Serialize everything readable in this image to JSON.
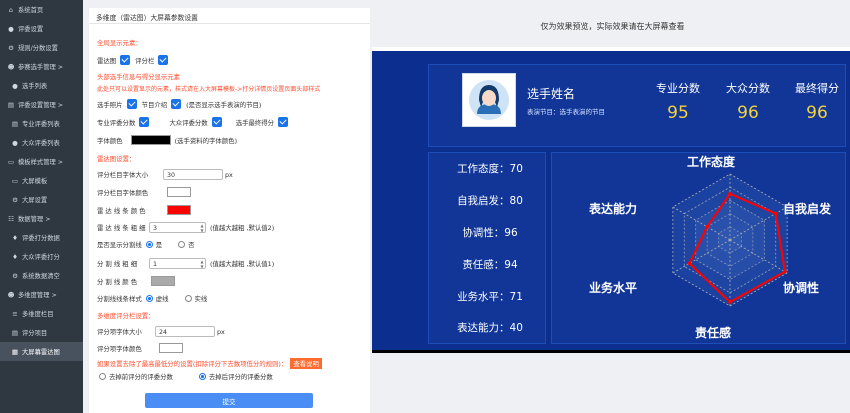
{
  "sidebar": {
    "items": [
      {
        "label": "系统首页",
        "icon": "home-icon",
        "glyph": "⌂"
      },
      {
        "label": "评委设置",
        "icon": "user-icon",
        "glyph": "●"
      },
      {
        "label": "规则/分数设置",
        "icon": "gear-icon",
        "glyph": "⚙"
      },
      {
        "label": "参赛选手管理 >",
        "icon": "group-icon",
        "glyph": "☻"
      },
      {
        "label": "选手列表",
        "icon": "user-icon",
        "glyph": "●"
      },
      {
        "label": "评委设置管理 >",
        "icon": "doc-icon",
        "glyph": "▤"
      },
      {
        "label": "专业评委列表",
        "icon": "doc-icon",
        "glyph": "▤"
      },
      {
        "label": "大众评委列表",
        "icon": "user-icon",
        "glyph": "●"
      },
      {
        "label": "模板样式管理 >",
        "icon": "monitor-icon",
        "glyph": "▭"
      },
      {
        "label": "大屏模板",
        "icon": "monitor-icon",
        "glyph": "▭"
      },
      {
        "label": "大屏设置",
        "icon": "gear-icon",
        "glyph": "⚙"
      },
      {
        "label": "数据管理 >",
        "icon": "cart-icon",
        "glyph": "☷"
      },
      {
        "label": "评委打分数据",
        "icon": "bell-icon",
        "glyph": "♦"
      },
      {
        "label": "大众评委打分",
        "icon": "bell-icon",
        "glyph": "♦"
      },
      {
        "label": "系统数据清空",
        "icon": "gear-icon",
        "glyph": "⚙"
      },
      {
        "label": "多维度管理 >",
        "icon": "group-icon",
        "glyph": "☻"
      },
      {
        "label": "多维度栏目",
        "icon": "list-icon",
        "glyph": "≡"
      },
      {
        "label": "评分项目",
        "icon": "doc-icon",
        "glyph": "▤"
      },
      {
        "label": "大屏幕雷达图",
        "icon": "grid-icon",
        "glyph": "▦",
        "active": true
      }
    ]
  },
  "form": {
    "title": "多维度（雷达图）大屏幕参数设置",
    "sec_global": "全局显示元素：",
    "radar_label": "雷达图",
    "score_bar_label": "评分栏",
    "sec_header": "头部选手信息与得分显示元素",
    "header_note": "此处只可以设置显示的元素，样式请在入大屏幕模板->打分详情页设置页面头部样式",
    "photo_label": "选手照片",
    "program_label": "节目介绍",
    "program_note": "(是否显示选手表演的节目)",
    "pro_score_label": "专业评委分数",
    "public_score_label": "大众评委分数",
    "final_score_label": "选手最终得分",
    "font_color_label": "字体颜色",
    "font_color_note": "(选手资料的字体颜色)",
    "font_color": "#000000",
    "sec_radar": "雷达图设置：",
    "score_font_size_label": "评分栏目字体大小",
    "score_font_size": "30",
    "score_font_size_unit": "px",
    "score_font_color_label": "评分栏目字体颜色",
    "score_font_color": "#ffffff",
    "radar_line_color_label": "雷 达 线 条 颜 色",
    "radar_line_color": "#ff0000",
    "radar_line_width_label": "雷 达 线 条 粗 细",
    "radar_line_width": "3",
    "radar_line_width_note": "(值越大越粗 ,默认值2)",
    "split_line_show_label": "是否显示分割线",
    "yes": "是",
    "no": "否",
    "split_line_width_label": "分 割 线 粗 细",
    "split_line_width": "1",
    "split_line_width_note": "(值越大越粗 ,默认值1)",
    "split_line_color_label": "分 割 线 颜 色",
    "split_line_color": "#aaaaaa",
    "split_line_style_label": "分割线线条样式",
    "dashed": "虚线",
    "solid": "实线",
    "sec_multi": "多维度评分栏设置：",
    "item_font_size_label": "评分项字体大小",
    "item_font_size": "24",
    "item_font_size_unit": "px",
    "item_font_color_label": "评分项字体颜色",
    "item_font_color": "#ffffff",
    "sec_remove": "如果设置去除了最高最低分的设置(扣除评分下去数项低分的规则)：",
    "view_help": "查看说明",
    "opt_before": "去掉前评分的评委分数",
    "opt_after": "去掉后评分的评委分数",
    "submit": "提交"
  },
  "preview": {
    "notice": "仅为效果预览，实际效果请在大屏幕查看",
    "player_name": "选手姓名",
    "program_text": "表演节目：选手表演的节目",
    "scores": [
      {
        "label": "专业分数",
        "value": "95"
      },
      {
        "label": "大众分数",
        "value": "96"
      },
      {
        "label": "最终得分",
        "value": "96"
      }
    ],
    "metrics": [
      {
        "label": "工作态度：70"
      },
      {
        "label": "自我启发：80"
      },
      {
        "label": "协调性：96"
      },
      {
        "label": "责任感：94"
      },
      {
        "label": "业务水平：71"
      },
      {
        "label": "表达能力：40"
      }
    ]
  },
  "chart_data": {
    "type": "radar",
    "categories": [
      "工作态度",
      "自我启发",
      "协调性",
      "责任感",
      "业务水平",
      "表达能力"
    ],
    "values": [
      70,
      80,
      96,
      94,
      71,
      40
    ],
    "max": 100,
    "line_color": "#ff0000"
  }
}
